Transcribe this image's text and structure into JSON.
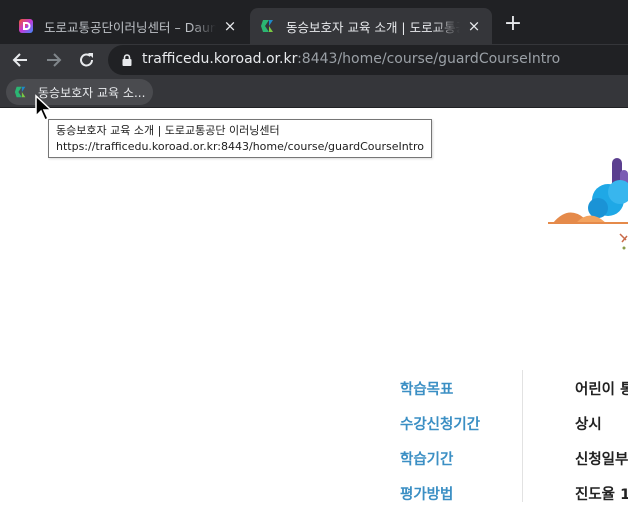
{
  "browser": {
    "tabs": [
      {
        "title": "도로교통공단이러닝센터 – Daum",
        "close_glyph": "×",
        "active": false,
        "favicon": "daum-icon"
      },
      {
        "title": "동승보호자 교육 소개 | 도로교통공단 이러닝센터",
        "close_glyph": "×",
        "active": true,
        "favicon": "koroad-icon"
      }
    ],
    "new_tab_glyph": "+",
    "url_host": "trafficedu.koroad.or.kr",
    "url_rest": ":8443/home/course/guardCourseIntro",
    "bookmark_label": "동승보호자 교육 소...",
    "tooltip_title": "동승보호자 교육 소개 | 도로교통공단 이러닝센터",
    "tooltip_url": "https://trafficedu.koroad.or.kr:8443/home/course/guardCourseIntro"
  },
  "course_info": [
    {
      "label": "학습목표",
      "value": "어린이 통"
    },
    {
      "label": "수강신청기간",
      "value": "상시"
    },
    {
      "label": "학습기간",
      "value": "신청일부"
    },
    {
      "label": "평가방법",
      "value": "진도율 1"
    }
  ],
  "colors": {
    "label": "#3b8fc4",
    "tab_bar": "#202124",
    "toolbar": "#35363a"
  }
}
